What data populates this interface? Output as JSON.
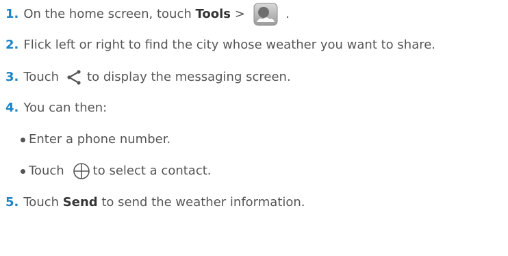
{
  "steps": [
    {
      "number": "1.",
      "text_before": "On the home screen, touch ",
      "bold": "Tools",
      "text_after": " > ",
      "icon": "weather-app-icon",
      "text_end": " ."
    },
    {
      "number": "2.",
      "text": "Flick left or right to find the city whose weather you want to share."
    },
    {
      "number": "3.",
      "text_before": "Touch",
      "icon": "share-icon",
      "text_after": "to display the messaging screen."
    },
    {
      "number": "4.",
      "text": "You can then:",
      "options": [
        {
          "text": "Enter a phone number."
        },
        {
          "text_before": "Touch",
          "icon": "plus-circle-icon",
          "text_after": "to select a contact."
        }
      ]
    },
    {
      "number": "5.",
      "text_before": "Touch ",
      "bold": "Send",
      "text_after": " to send the weather information."
    }
  ],
  "colors": {
    "number": "#1c84c6",
    "text": "#555555",
    "bold": "#333333"
  }
}
